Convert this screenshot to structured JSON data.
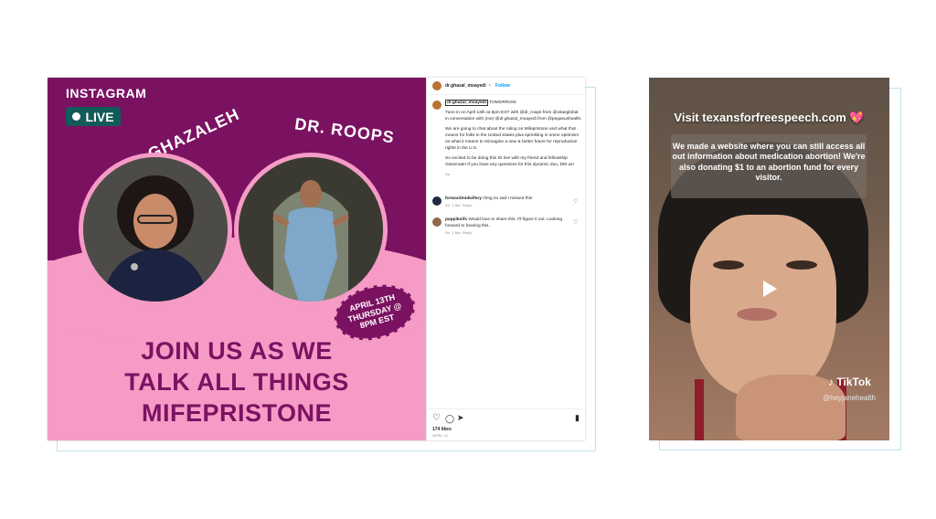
{
  "instagram_post": {
    "image": {
      "platform_label": "INSTAGRAM",
      "live_label": "LIVE",
      "host1_label": "DR. GHAZALEH",
      "host2_label": "DR. ROOPS",
      "date_stamp": [
        "APRIL 13TH",
        "THURSDAY @",
        "8PM EST"
      ],
      "headline": [
        "JOIN US AS WE",
        "TALK ALL THINGS",
        "MIFEPRISTONE"
      ]
    },
    "header": {
      "username": "dr.ghazal_moayedi",
      "follow_label": "Follow"
    },
    "caption": {
      "username": "dr.ghazal_moayedi",
      "lead": "TOMORROW",
      "paragraph1": "Tune in on April 13th at 8pm EST with @dr_roops from @vitaeglobal in conversation with (me) @dr.ghazal_moayedi from @pegasushealth.",
      "paragraph2": "We are going to chat about the ruling on Mifepristone and what that means for folks in the United States plus sprinkling in some optimism on what it means to reimagine a new & better future for reproductive rights in the U.S.",
      "paragraph3": "So excited to be doing this IG live with my friend and fellowship classmate! If you have any questions for this dynamic duo, DM us!",
      "age": "2w"
    },
    "comments": [
      {
        "username": "forwardmidwifery",
        "text": "Omg so sad I missed this",
        "meta": [
          "2w",
          "1 like",
          "Reply"
        ]
      },
      {
        "username": "pappikoifs",
        "text": "Would love to share this. I'll figure it out. Looking forward to hearing this.",
        "meta": [
          "2w",
          "1 like",
          "Reply"
        ]
      }
    ],
    "likes": "174 likes",
    "date": "APRIL 12"
  },
  "tiktok_post": {
    "headline": "Visit texansforfreespeech.com",
    "overlay_text": "We made a website where you can still access all out information about medication abortion! We're also donating $1 to an abortion fund for every visitor.",
    "logo_text": "TikTok",
    "handle": "@heyjanehealth"
  },
  "colors": {
    "purple": "#7b1261",
    "pink": "#f59bc6",
    "teal": "#115b5a",
    "link_blue": "#00376b"
  }
}
